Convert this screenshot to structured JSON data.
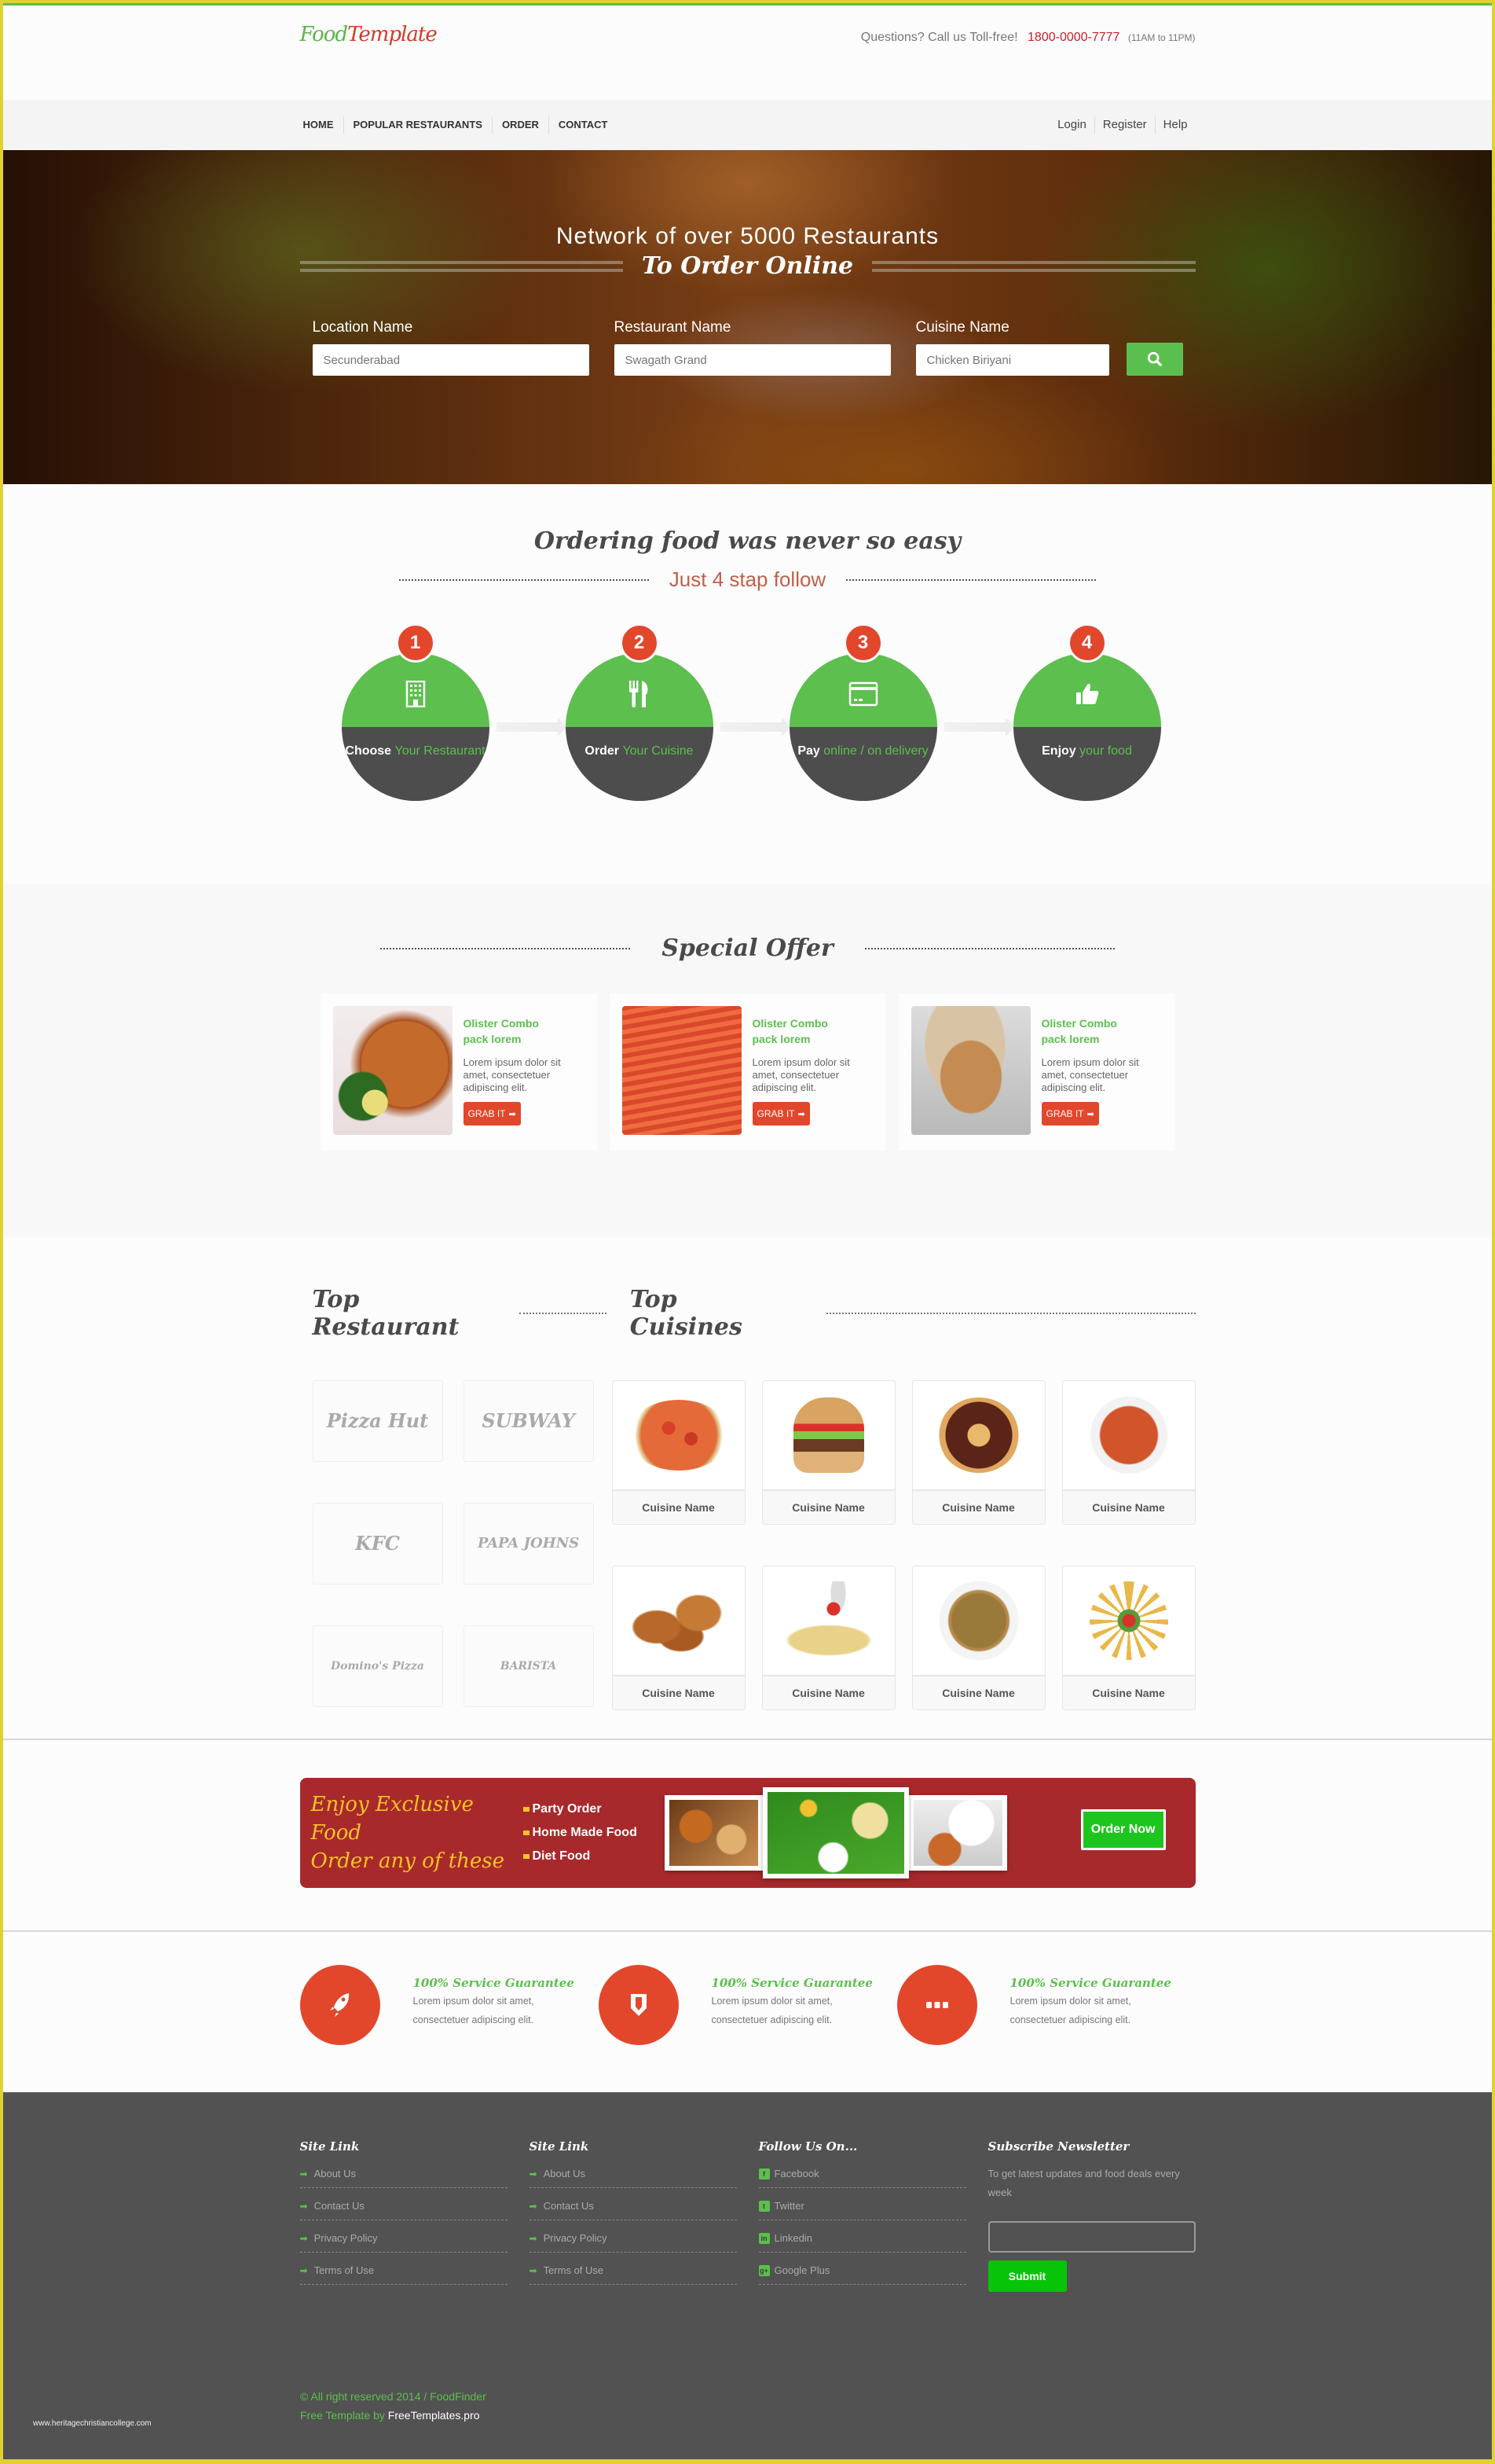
{
  "header": {
    "logo_part1": "Food",
    "logo_part2": "Template",
    "contact_text": "Questions? Call us Toll-free!",
    "phone": "1800-0000-7777",
    "hours": "(11AM to 11PM)"
  },
  "nav": {
    "left": [
      {
        "label": "HOME"
      },
      {
        "label": "POPULAR RESTAURANTS"
      },
      {
        "label": "ORDER"
      },
      {
        "label": "CONTACT"
      }
    ],
    "right": [
      {
        "label": "Login"
      },
      {
        "label": "Register"
      },
      {
        "label": "Help"
      }
    ]
  },
  "hero": {
    "subtitle": "Network of over 5000 Restaurants",
    "title": "To Order Online",
    "fields": [
      {
        "label": "Location Name",
        "placeholder": "Secunderabad",
        "value": ""
      },
      {
        "label": "Restaurant Name",
        "placeholder": "Swagath Grand",
        "value": ""
      },
      {
        "label": "Cuisine Name",
        "placeholder": "Chicken Biriyani",
        "value": ""
      }
    ],
    "search_icon": "search-icon"
  },
  "steps": {
    "title": "Ordering food was never so easy",
    "subtitle": "Just 4 stap follow",
    "items": [
      {
        "number": "1",
        "icon": "building-icon",
        "bold": "Choose",
        "rest": "Your Restaurant"
      },
      {
        "number": "2",
        "icon": "fork-knife-icon",
        "bold": "Order",
        "rest": "Your Cuisine"
      },
      {
        "number": "3",
        "icon": "credit-card-icon",
        "bold": "Pay",
        "rest": "online / on delivery"
      },
      {
        "number": "4",
        "icon": "thumbs-up-icon",
        "bold": "Enjoy",
        "rest": "your food"
      }
    ]
  },
  "special_offer": {
    "title": "Special Offer",
    "cards": [
      {
        "name": "Olister Combo pack lorem",
        "desc": "Lorem ipsum dolor sit amet, consectetuer adipiscing elit.",
        "button": "GRAB IT",
        "image": "roast-chicken"
      },
      {
        "name": "Olister Combo pack lorem",
        "desc": "Lorem ipsum dolor sit amet, consectetuer adipiscing elit.",
        "button": "GRAB IT",
        "image": "crabs"
      },
      {
        "name": "Olister Combo pack lorem",
        "desc": "Lorem ipsum dolor sit amet, consectetuer adipiscing elit.",
        "button": "GRAB IT",
        "image": "scallop"
      }
    ]
  },
  "top": {
    "restaurant_title": "Top Restaurant",
    "cuisine_title": "Top Cuisines",
    "restaurants": [
      {
        "name": "Pizza Hut"
      },
      {
        "name": "SUBWAY"
      },
      {
        "name": "KFC"
      },
      {
        "name": "PAPA JOHNS"
      },
      {
        "name": "Domino's Pizza"
      },
      {
        "name": "BARISTA"
      }
    ],
    "cuisines": [
      {
        "label": "Cuisine Name",
        "image": "pizza"
      },
      {
        "label": "Cuisine Name",
        "image": "burger"
      },
      {
        "label": "Cuisine Name",
        "image": "donut"
      },
      {
        "label": "Cuisine Name",
        "image": "curry"
      },
      {
        "label": "Cuisine Name",
        "image": "fried-chicken"
      },
      {
        "label": "Cuisine Name",
        "image": "pasta-salad"
      },
      {
        "label": "Cuisine Name",
        "image": "fried-rice"
      },
      {
        "label": "Cuisine Name",
        "image": "penne"
      }
    ]
  },
  "promo": {
    "title_line1": "Enjoy Exclusive Food",
    "title_line2": "Order any of these",
    "items": [
      "Party Order",
      "Home Made Food",
      "Diet Food"
    ],
    "button": "Order Now",
    "colors": {
      "background": "#a8292b",
      "accent": "#f7c326",
      "button": "#1ec51e"
    }
  },
  "guarantees": [
    {
      "icon": "rocket-icon",
      "title": "100% Service Guarantee",
      "desc": "Lorem ipsum dolor sit amet, consectetuer adipiscing elit."
    },
    {
      "icon": "shield-icon",
      "title": "100% Service Guarantee",
      "desc": "Lorem ipsum dolor sit amet, consectetuer adipiscing elit."
    },
    {
      "icon": "more-dots-icon",
      "title": "100% Service Guarantee",
      "desc": "Lorem ipsum dolor sit amet, consectetuer adipiscing elit."
    }
  ],
  "footer": {
    "col1": {
      "title": "Site Link",
      "links": [
        "About Us",
        "Contact Us",
        "Privacy Policy",
        "Terms of Use"
      ]
    },
    "col2": {
      "title": "Site Link",
      "links": [
        "About Us",
        "Contact Us",
        "Privacy Policy",
        "Terms of Use"
      ]
    },
    "social": {
      "title": "Follow Us On...",
      "links": [
        {
          "label": "Facebook",
          "glyph": "f",
          "icon": "facebook-icon"
        },
        {
          "label": "Twitter",
          "glyph": "t",
          "icon": "twitter-icon"
        },
        {
          "label": "Linkedin",
          "glyph": "in",
          "icon": "linkedin-icon"
        },
        {
          "label": "Google Plus",
          "glyph": "g+",
          "icon": "google-plus-icon"
        }
      ]
    },
    "newsletter": {
      "title": "Subscribe Newsletter",
      "desc": "To get latest updates and food deals every week",
      "input_value": "",
      "button": "Submit"
    },
    "copyright": "© All right reserved 2014 / FoodFinder",
    "credit_prefix": "Free Template by",
    "credit_link": "FreeTemplates.pro",
    "watermark": "www.heritagechristiancollege.com"
  },
  "colors": {
    "green": "#5cbf4e",
    "red": "#e2472c",
    "dark": "#4d4d4d",
    "footer_bg": "#525252",
    "frame_yellow": "#e2cf34"
  }
}
